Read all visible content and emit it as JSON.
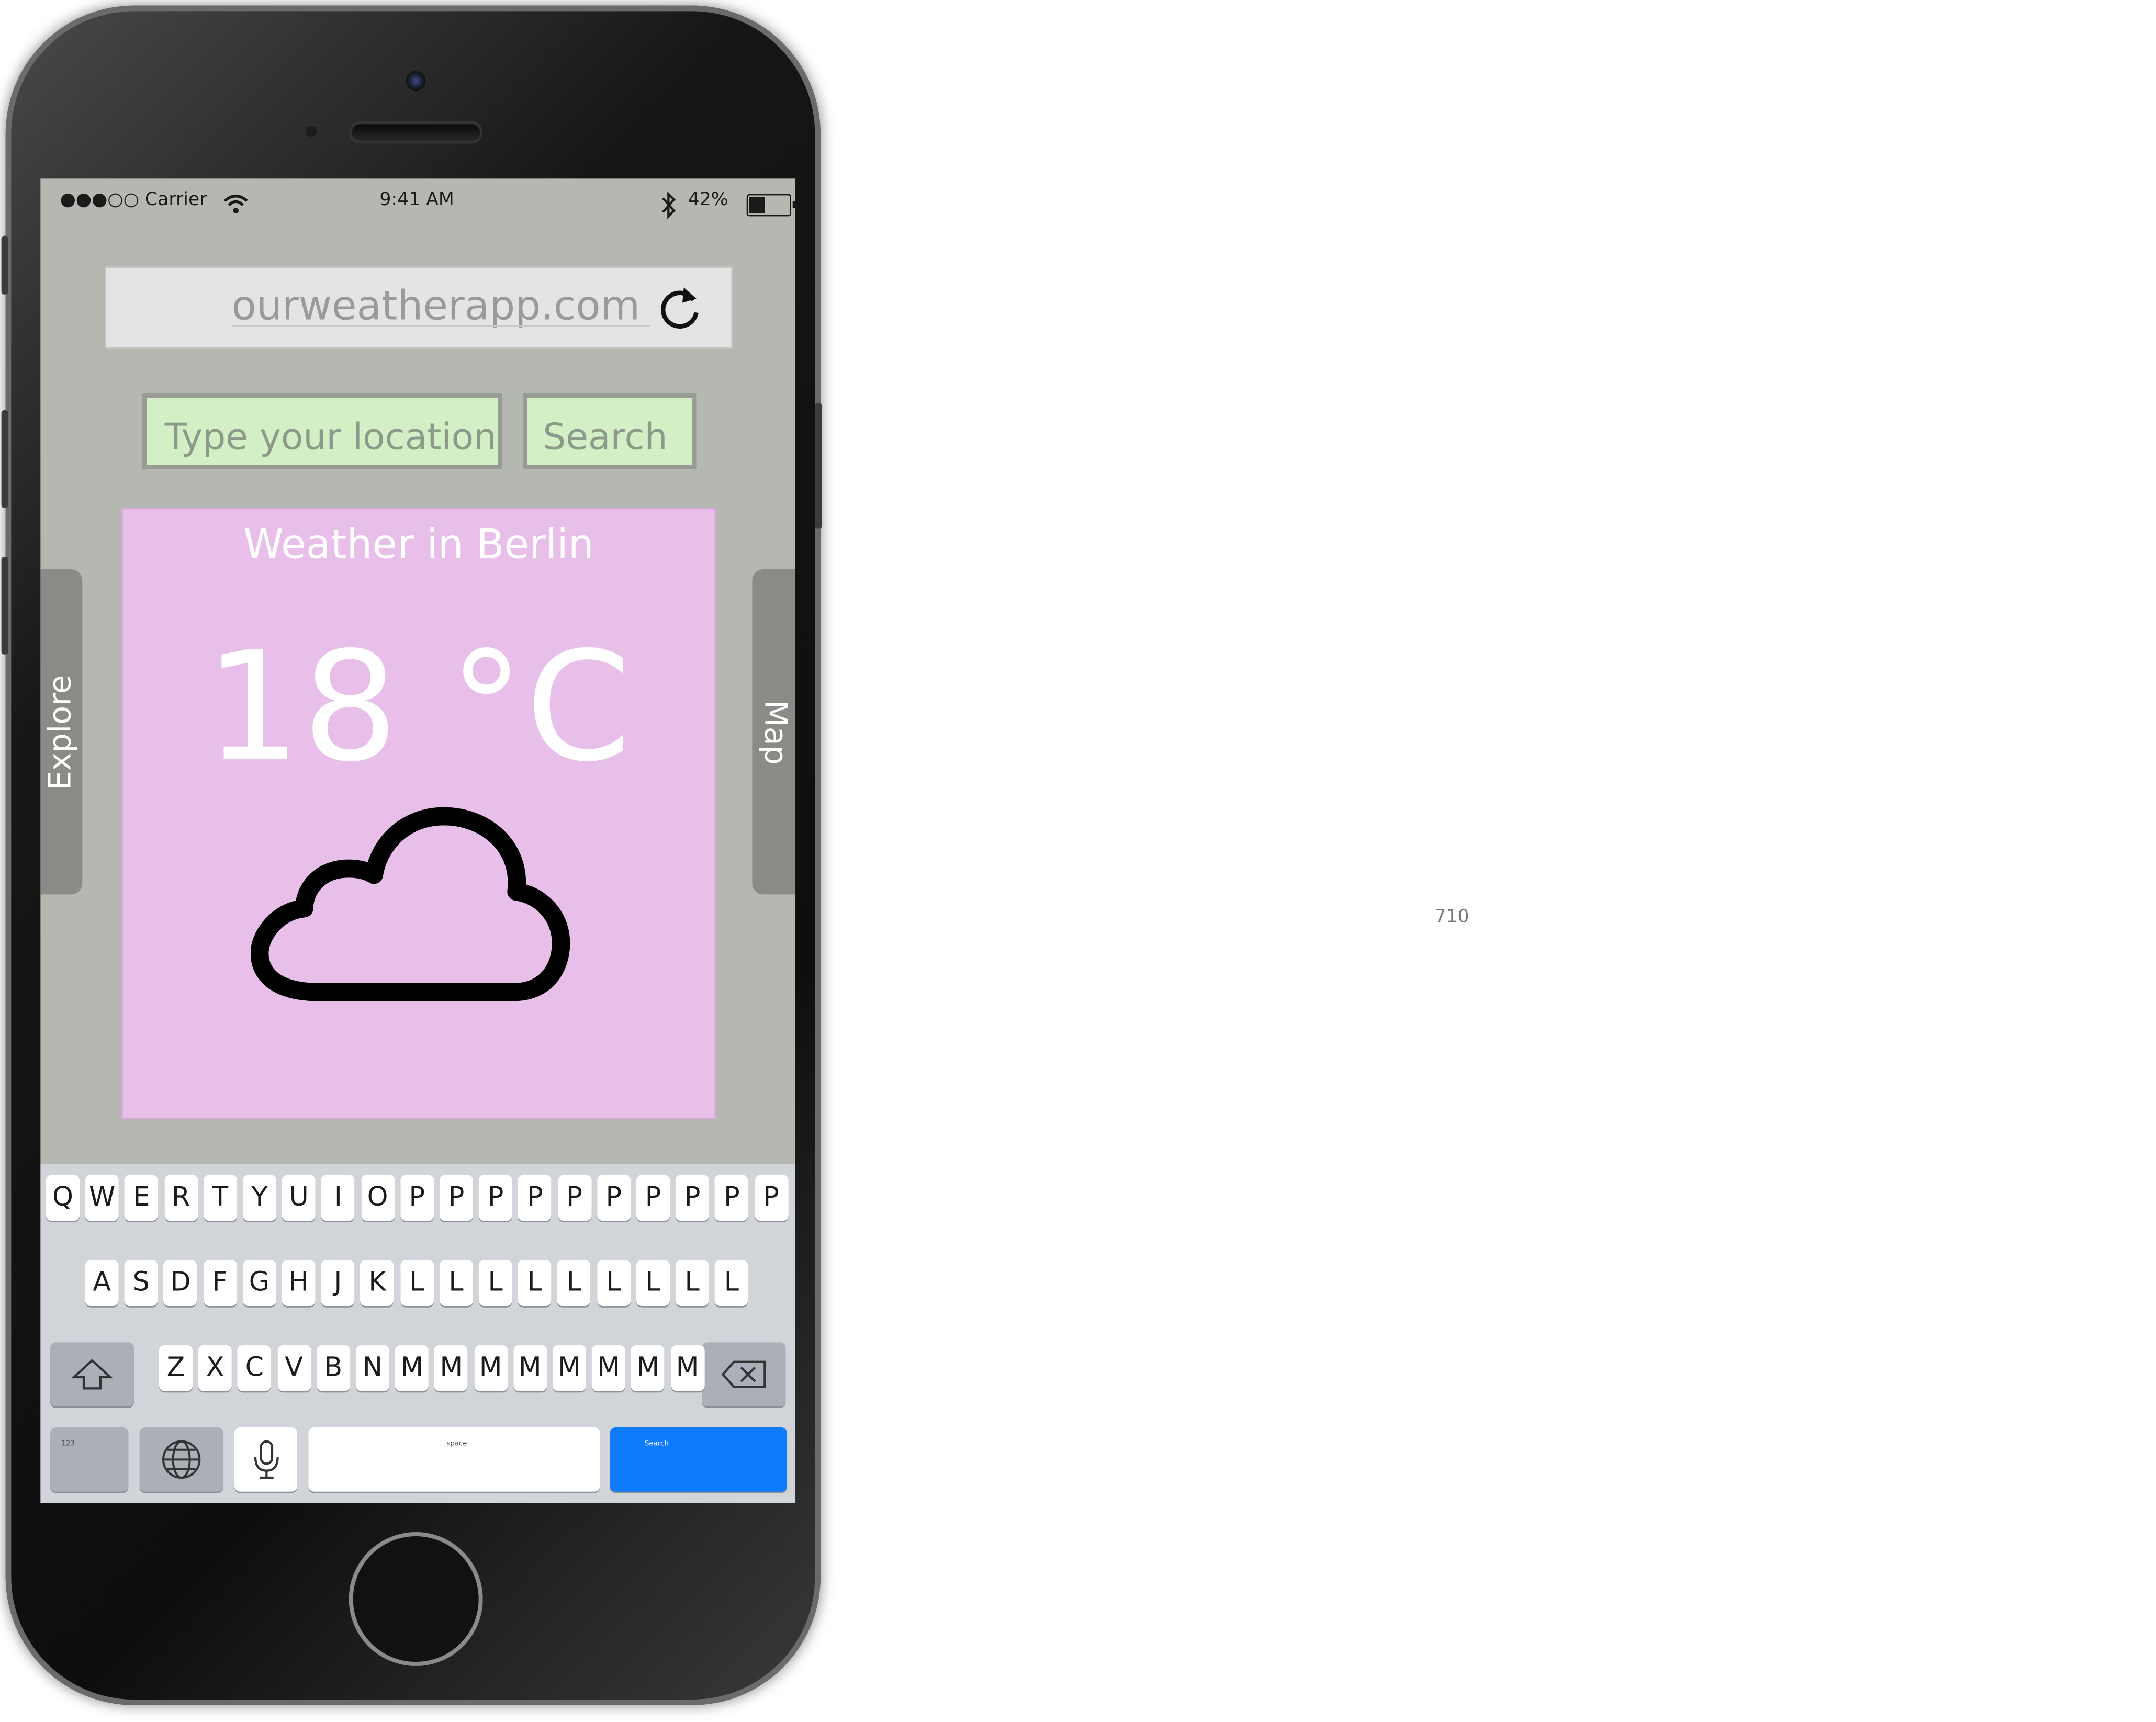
{
  "status_bar": {
    "carrier": "●●●○○ Carrier",
    "time": "9:41 AM",
    "battery": "42%",
    "battery_level": 0.42
  },
  "browser": {
    "url": "ourweatherapp.com"
  },
  "search": {
    "placeholder": "Type your location",
    "button_label": "Search"
  },
  "weather": {
    "title": "Weather in Berlin",
    "temperature": "18 °C",
    "condition_icon": "cloud-icon"
  },
  "side_tabs": {
    "left": "Explore",
    "right": "Map"
  },
  "keyboard": {
    "row1": [
      "Q",
      "W",
      "E",
      "R",
      "T",
      "Y",
      "U",
      "I",
      "O",
      "P",
      "P",
      "P",
      "P",
      "P",
      "P",
      "P",
      "P",
      "P",
      "P"
    ],
    "row2": [
      "A",
      "S",
      "D",
      "F",
      "G",
      "H",
      "J",
      "K",
      "L",
      "L",
      "L",
      "L",
      "L",
      "L",
      "L",
      "L",
      "L"
    ],
    "row3": [
      "Z",
      "X",
      "C",
      "V",
      "B",
      "N",
      "M",
      "M",
      "M",
      "M",
      "M",
      "M",
      "M",
      "M"
    ],
    "numbers_label": "123",
    "space_label": "space",
    "return_label": "Search"
  },
  "page_number": "710"
}
